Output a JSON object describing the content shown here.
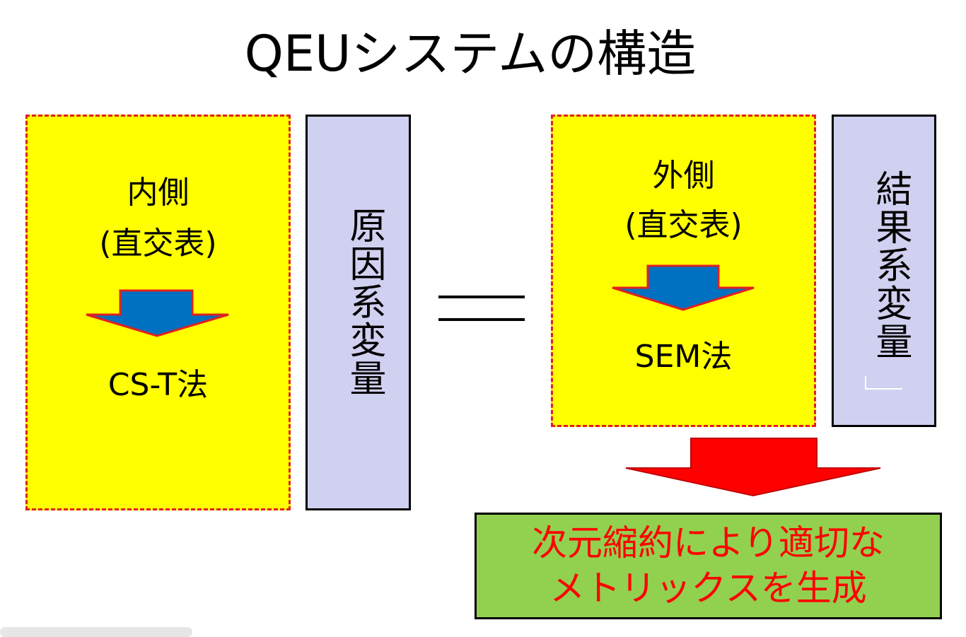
{
  "title": "QEUシステムの構造",
  "inner": {
    "label": "内側",
    "sub": "(直交表)",
    "method": "CS-T法"
  },
  "cause": {
    "label": "原因系変量"
  },
  "outer": {
    "label": "外側",
    "sub": "(直交表)",
    "method": "SEM法"
  },
  "result": {
    "label": "結果系変量"
  },
  "conclusion": {
    "line1": "次元縮約により適切な",
    "line2": "メトリックスを生成"
  },
  "colors": {
    "box_fill": "#ffff00",
    "dashed_border": "#e02020",
    "variable_fill": "#d0d0f0",
    "blue_arrow": "#0070c0",
    "red_arrow": "#ff0000",
    "conclusion_fill": "#92d050",
    "conclusion_text": "#ff0000"
  }
}
